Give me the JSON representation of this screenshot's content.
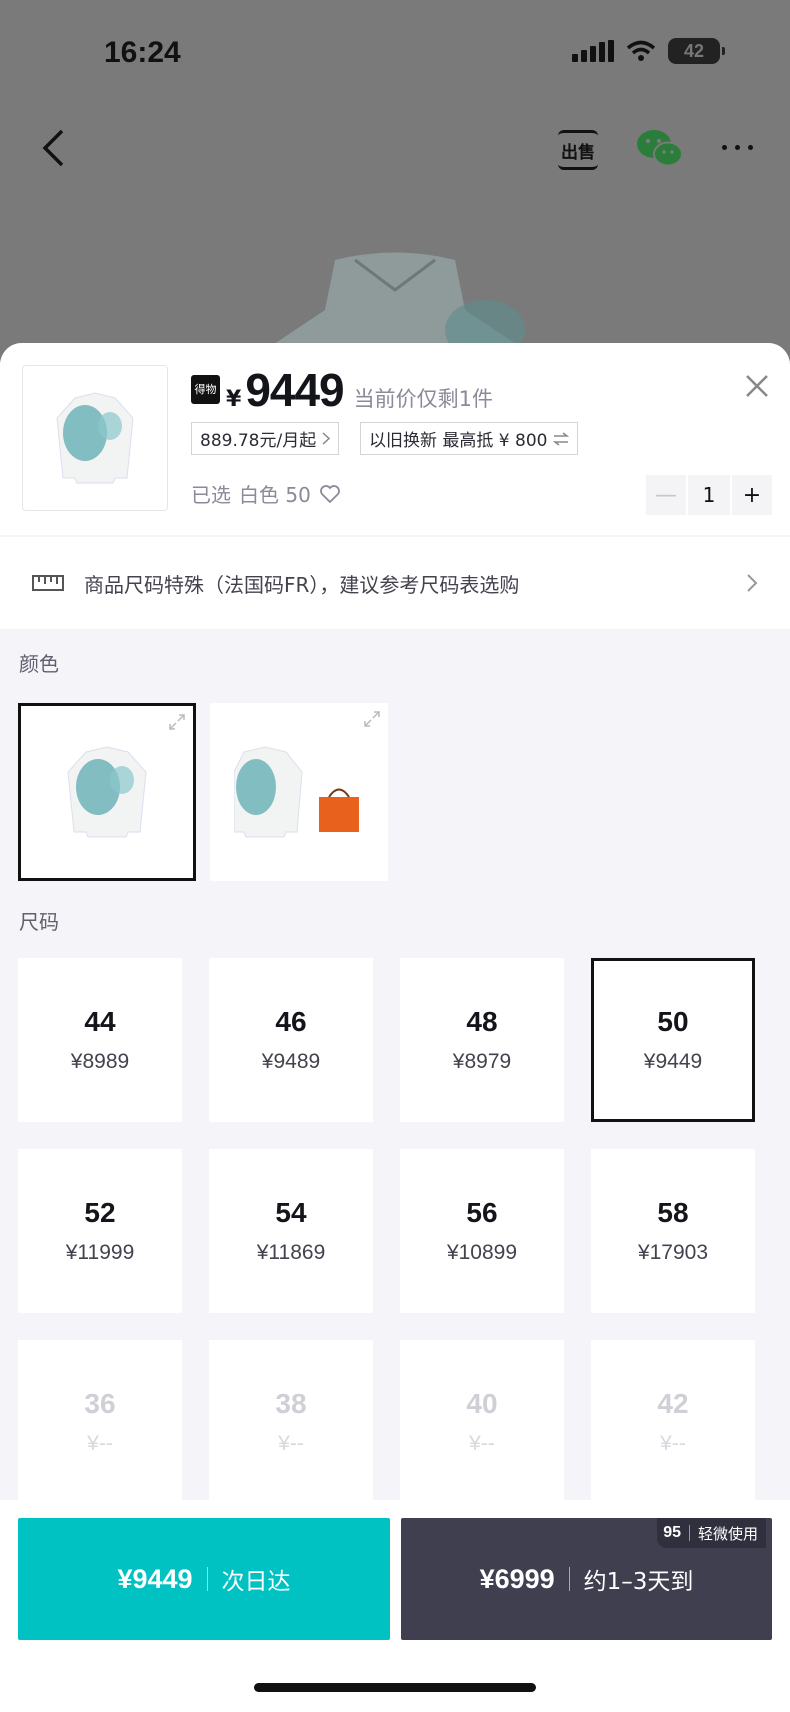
{
  "status_bar": {
    "time": "16:24",
    "battery": "42"
  },
  "header": {
    "sell_label": "出售"
  },
  "product": {
    "brand_badge": "得物",
    "currency": "¥",
    "price": "9449",
    "price_note": "当前价仅剩1件",
    "installment": "889.78元/月起",
    "trade_in": "以旧换新 最高抵 ¥ 800",
    "selected_label": "已选",
    "selected_value": "白色 50",
    "quantity": "1"
  },
  "size_tip": "商品尺码特殊（法国码FR），建议参考尺码表选购",
  "color_section": {
    "label": "颜色"
  },
  "size_section": {
    "label": "尺码",
    "sizes": [
      {
        "size": "44",
        "price": "¥8989"
      },
      {
        "size": "46",
        "price": "¥9489"
      },
      {
        "size": "48",
        "price": "¥8979"
      },
      {
        "size": "50",
        "price": "¥9449"
      },
      {
        "size": "52",
        "price": "¥11999"
      },
      {
        "size": "54",
        "price": "¥11869"
      },
      {
        "size": "56",
        "price": "¥10899"
      },
      {
        "size": "58",
        "price": "¥17903"
      },
      {
        "size": "36",
        "price": "¥--"
      },
      {
        "size": "38",
        "price": "¥--"
      },
      {
        "size": "40",
        "price": "¥--"
      },
      {
        "size": "42",
        "price": "¥--"
      }
    ]
  },
  "footer": {
    "fast": {
      "price": "¥9449",
      "delivery": "次日达"
    },
    "slow": {
      "price": "¥6999",
      "delivery": "约1–3天到",
      "condition_grade": "95",
      "condition_text": "轻微使用"
    }
  },
  "colors": {
    "accent": "#01c2c3",
    "dark_button": "#3f3f50"
  }
}
